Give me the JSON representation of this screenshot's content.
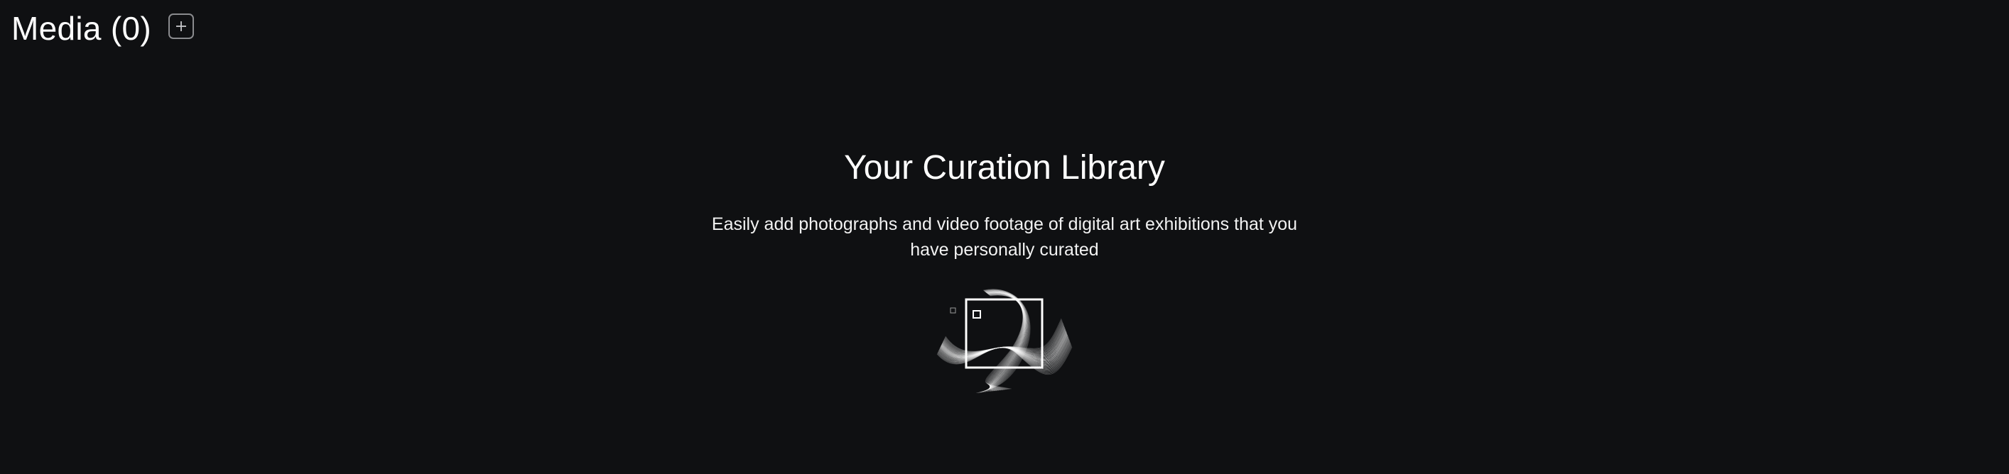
{
  "header": {
    "title": "Media (0)",
    "add_button_icon": "plus-icon"
  },
  "empty_state": {
    "title": "Your Curation Library",
    "description": "Easily add photographs and video footage of digital art exhibitions that you have personally curated",
    "illustration": "wave-frame-illustration"
  },
  "colors": {
    "background": "#0f1012",
    "text": "#ffffff",
    "button_border": "#8a8b8e"
  }
}
